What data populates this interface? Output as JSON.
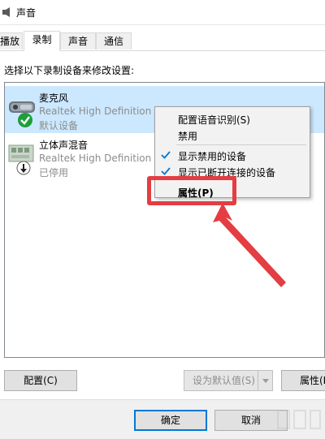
{
  "window": {
    "title": "声音"
  },
  "tabs": [
    {
      "label": "播放",
      "active": false
    },
    {
      "label": "录制",
      "active": true
    },
    {
      "label": "声音",
      "active": false
    },
    {
      "label": "通信",
      "active": false
    }
  ],
  "instruction": "选择以下录制设备来修改设置:",
  "devices": [
    {
      "name": "麦克风",
      "driver": "Realtek High Definition Audio",
      "status": "默认设备",
      "selected": true,
      "icon": "microphone-icon",
      "badge": "default-check-icon"
    },
    {
      "name": "立体声混音",
      "driver": "Realtek High Definition Audio",
      "status": "已停用",
      "selected": false,
      "icon": "stereo-mix-icon",
      "badge": "disabled-arrow-icon"
    }
  ],
  "context_menu": {
    "items": [
      {
        "label": "配置语音识别(S)",
        "checked": false
      },
      {
        "label": "禁用",
        "checked": false
      },
      {
        "label": "显示禁用的设备",
        "checked": true
      },
      {
        "label": "显示已断开连接的设备",
        "checked": true
      },
      {
        "label": "属性(P)",
        "checked": false,
        "bold": true
      }
    ]
  },
  "buttons": {
    "configure": "配置(C)",
    "set_default": "设为默认值(S)",
    "properties": "属性(P)",
    "ok": "确定",
    "cancel": "取消"
  },
  "colors": {
    "selection": "#cce8ff",
    "highlight": "#e43d42",
    "check": "#0078d7",
    "default_badge": "#1e9e3a"
  }
}
